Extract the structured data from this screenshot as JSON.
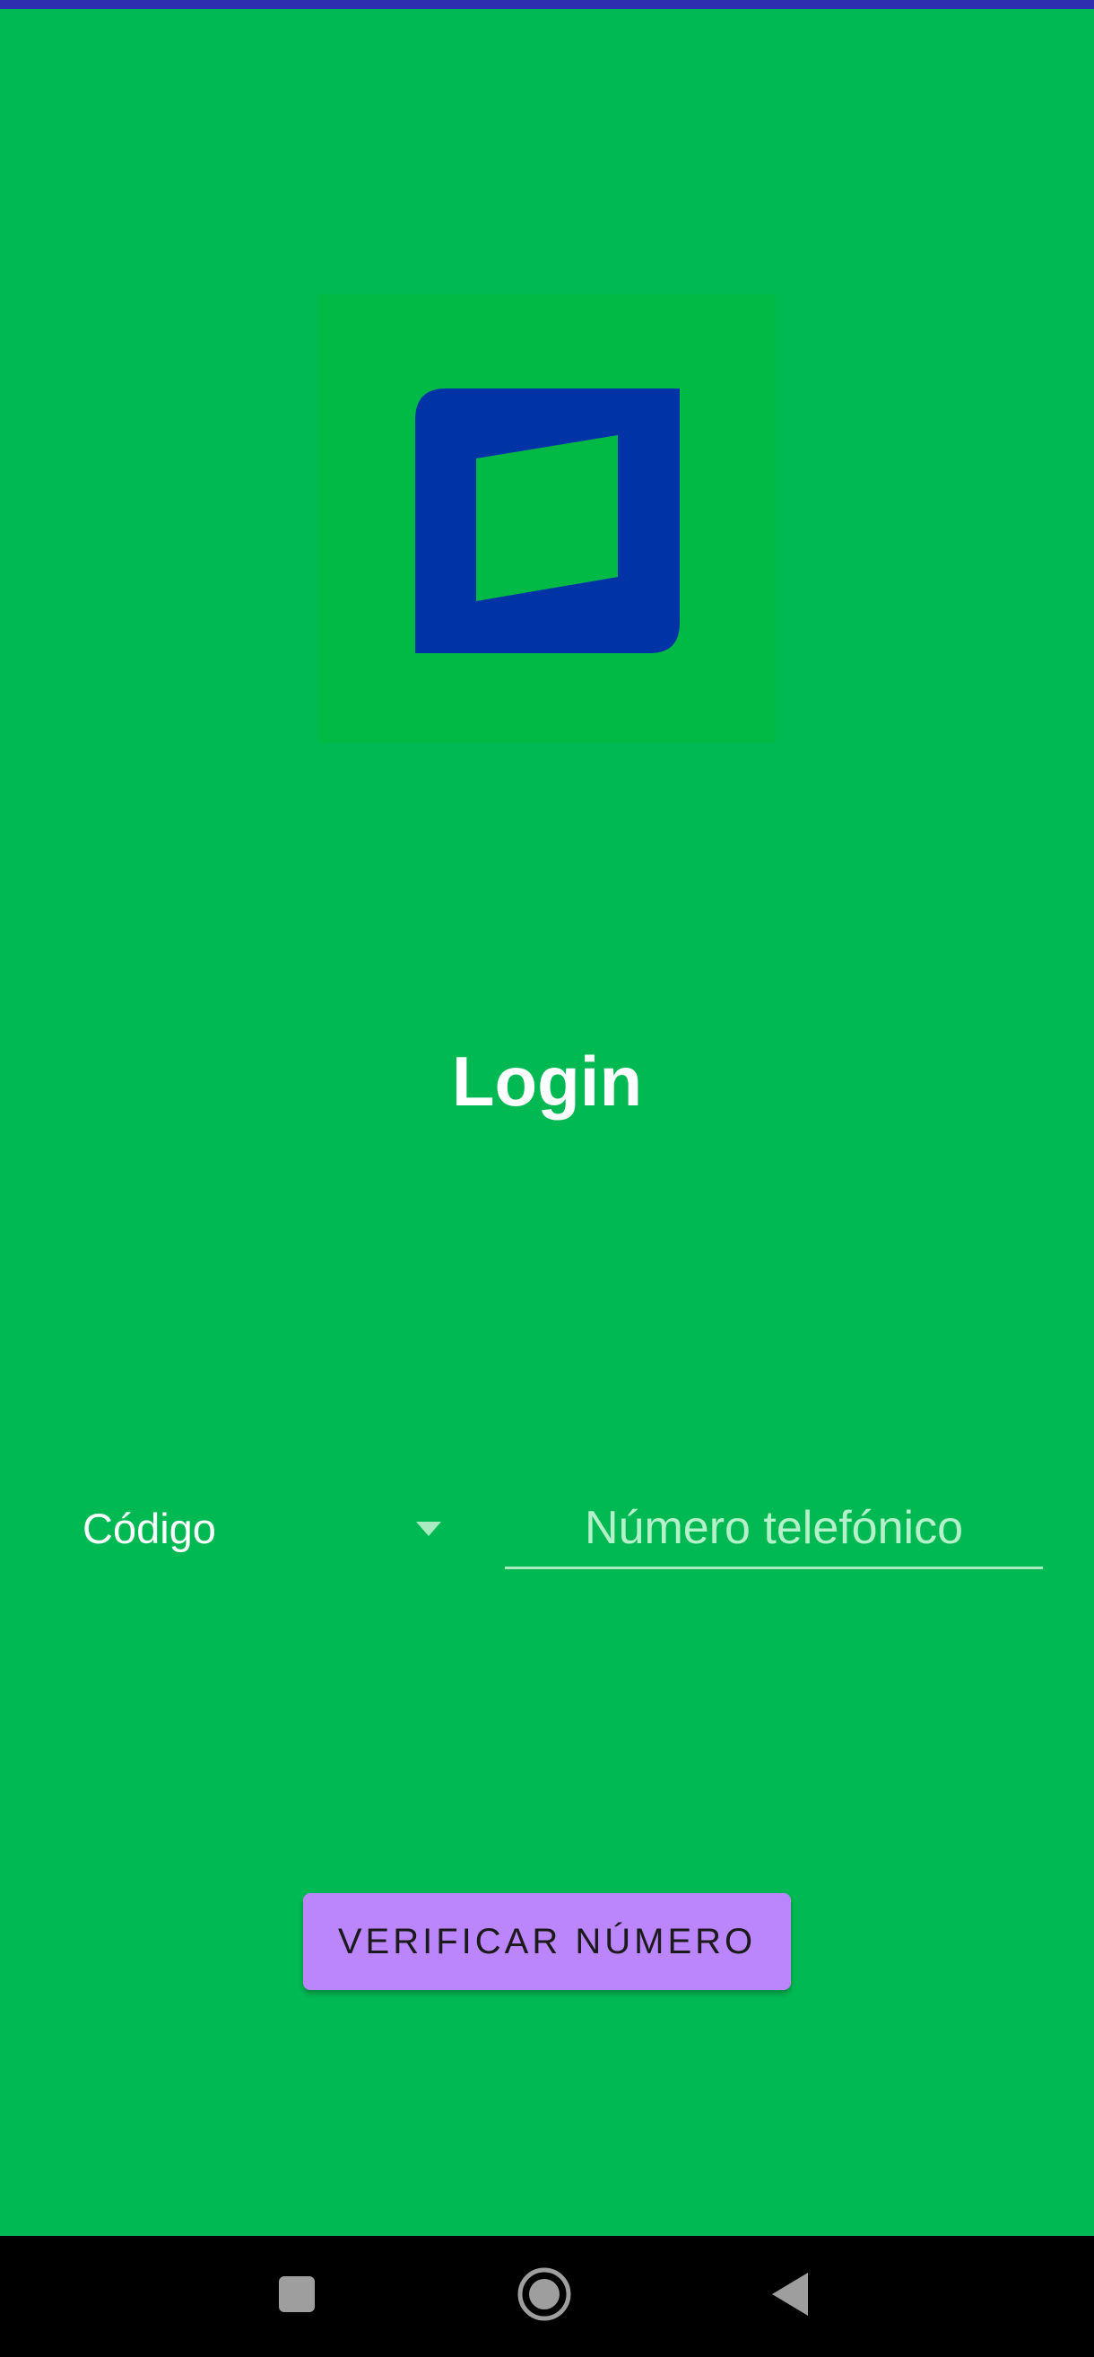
{
  "app": {
    "background_color": "#00B953",
    "status_strip_color": "#2E2FB0"
  },
  "logo": {
    "icon": "app-logo-icon",
    "outer_color": "#0033A6",
    "inner_color": "#00BA45"
  },
  "title": "Login",
  "form": {
    "code_label": "Código",
    "phone_placeholder": "Número telefónico",
    "phone_value": "",
    "verify_button": "VERIFICAR NÚMERO",
    "button_color": "#BB86FC"
  },
  "nav": {
    "recents_icon": "square-icon",
    "home_icon": "circle-icon",
    "back_icon": "triangle-back-icon"
  }
}
